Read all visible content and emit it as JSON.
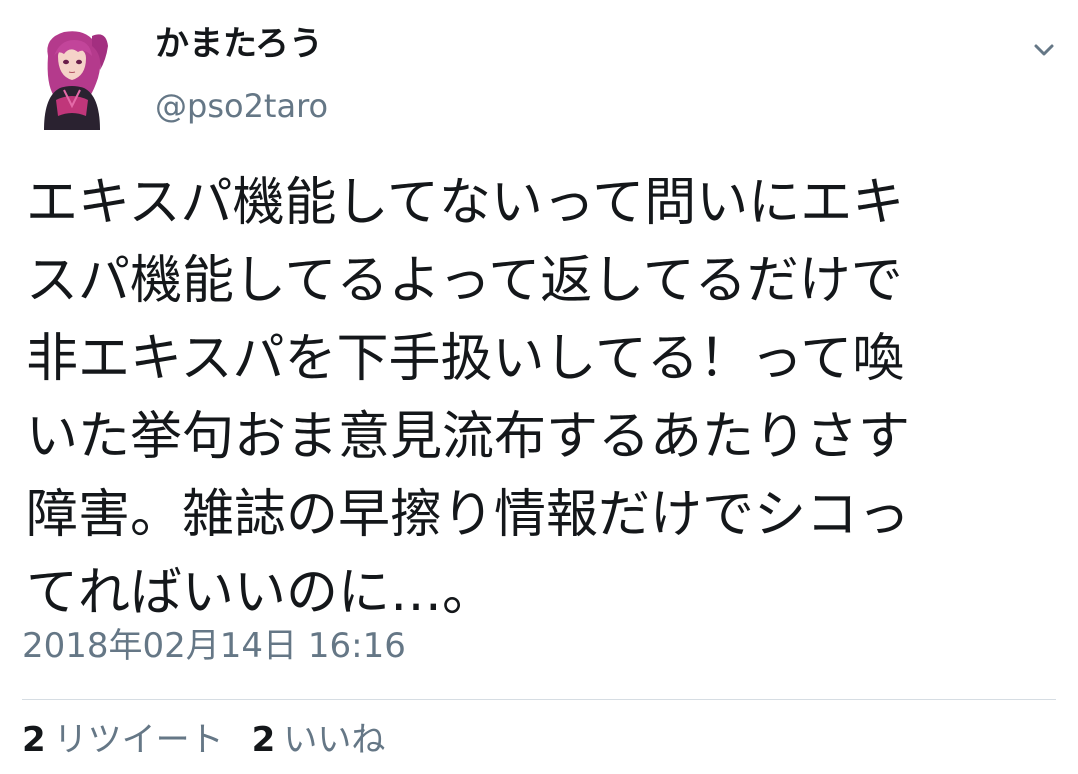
{
  "user": {
    "display_name": "かまたろう",
    "handle": "@pso2taro",
    "avatar_icon": "avatar-anime-character"
  },
  "menu": {
    "icon": "chevron-down-icon"
  },
  "tweet": {
    "lines": [
      "エキスパ機能してないって問いにエキ",
      "スパ機能してるよって返してるだけで",
      "非エキスパを下手扱いしてる！って喚",
      "いた挙句おま意見流布するあたりさす",
      "障害。雑誌の早擦り情報だけでシコっ",
      "てればいいのに…。"
    ],
    "timestamp": "2018年02月14日 16:16"
  },
  "stats": {
    "retweets": {
      "count": "2",
      "label": "リツイート"
    },
    "likes": {
      "count": "2",
      "label": "いいね"
    }
  },
  "colors": {
    "text": "#14171a",
    "secondary": "#657786",
    "divider": "#d6dde3"
  }
}
